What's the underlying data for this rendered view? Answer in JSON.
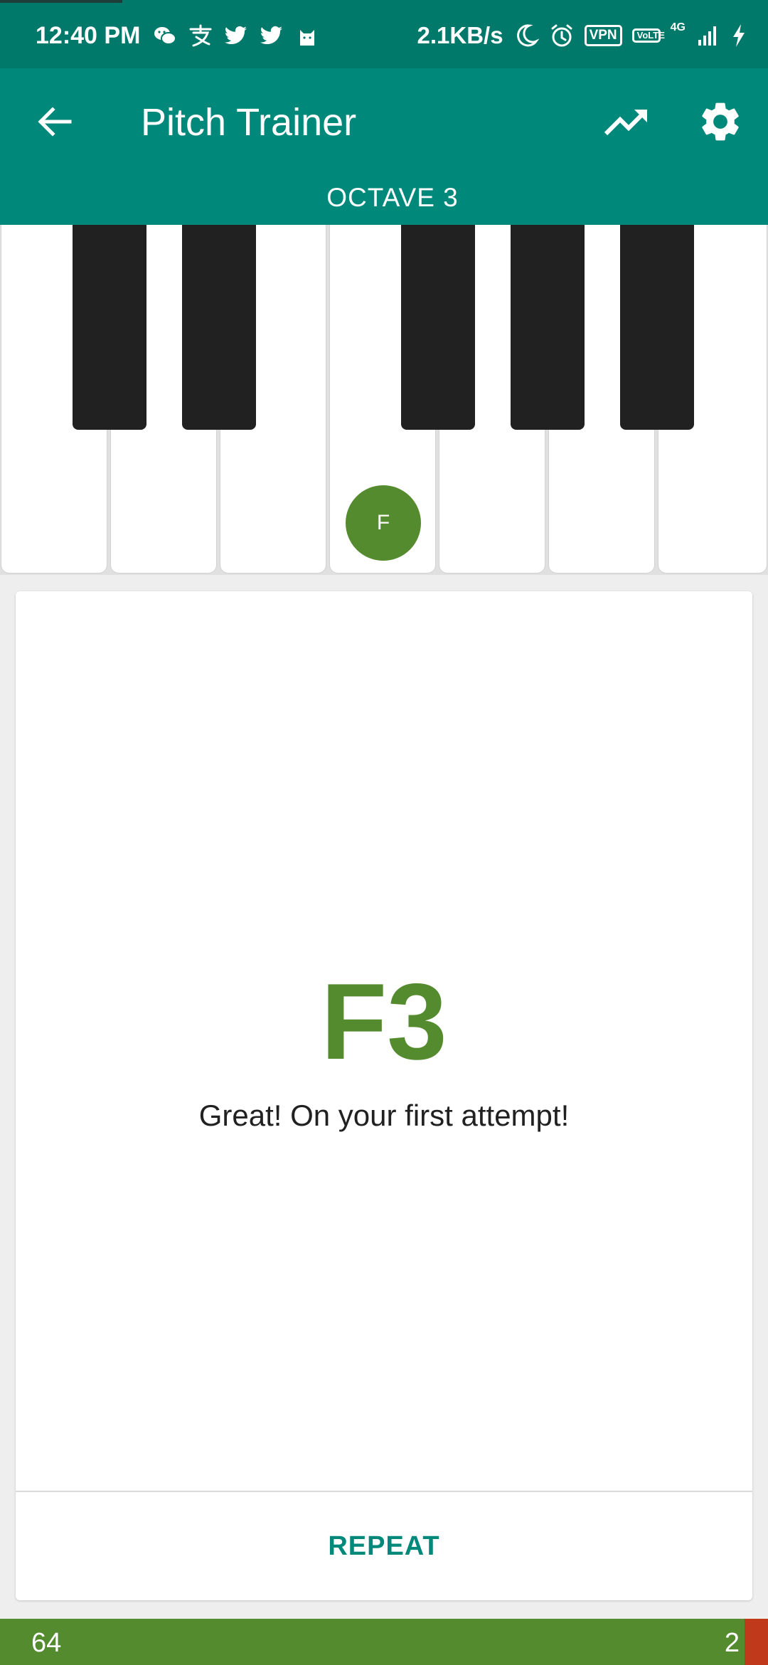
{
  "status_bar": {
    "time": "12:40 PM",
    "left_icons": [
      "wechat-icon",
      "alipay-icon",
      "twitter-icon",
      "twitter-icon",
      "cat-icon"
    ],
    "network_speed": "2.1KB/s",
    "vpn_label": "VPN",
    "volte_label": "VoLTE",
    "network_type": "4G",
    "right_icons": [
      "moon-icon",
      "alarm-icon",
      "vpn-icon",
      "volte-icon",
      "signal-icon",
      "charging-icon"
    ]
  },
  "app_bar": {
    "title": "Pitch Trainer",
    "back_icon": "arrow-back-icon",
    "stats_icon": "trending-up-icon",
    "settings_icon": "gear-icon",
    "octave_label": "OCTAVE 3",
    "color": "#00897b"
  },
  "keyboard": {
    "white_keys": 7,
    "black_keys": 5,
    "highlighted_note": "F",
    "highlight_color": "#558b2f"
  },
  "result": {
    "note": "F3",
    "message": "Great! On your first attempt!",
    "note_color": "#558b2f"
  },
  "actions": {
    "repeat_label": "REPEAT",
    "accent_color": "#00897b"
  },
  "score": {
    "correct": "64",
    "wrong": "2",
    "correct_color": "#558b2f",
    "wrong_color": "#c0391b"
  }
}
